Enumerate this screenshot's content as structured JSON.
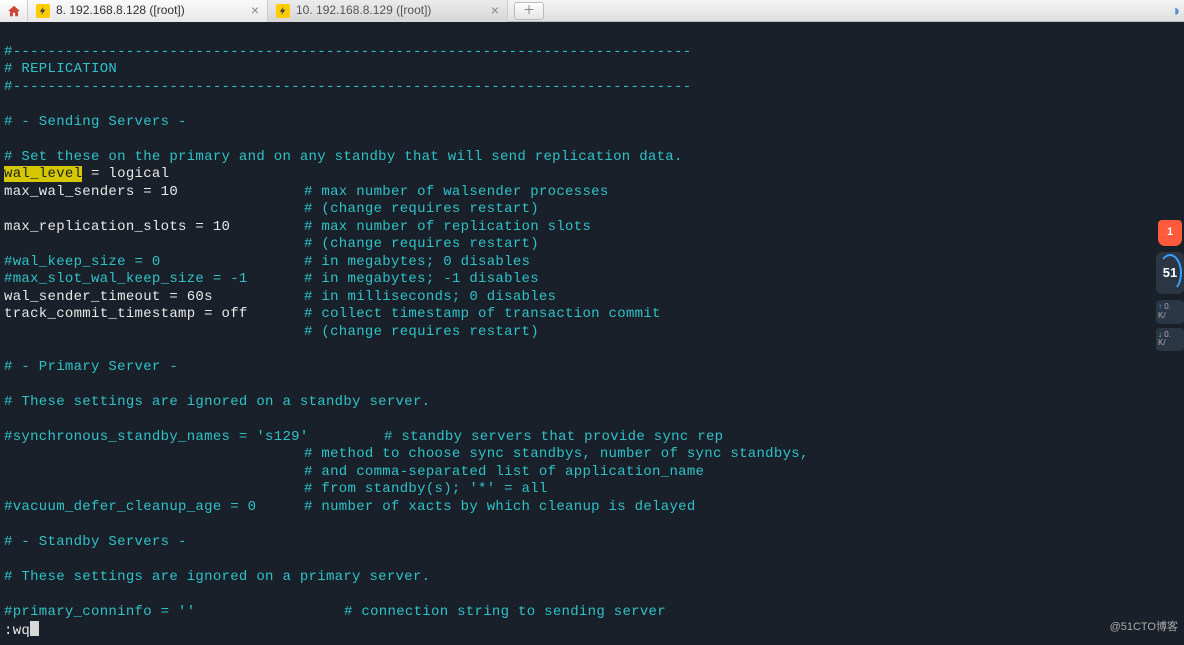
{
  "tabs": [
    {
      "label": "8. 192.168.8.128 ([root])",
      "active": true
    },
    {
      "label": "10. 192.168.8.129 ([root])",
      "active": false
    }
  ],
  "lines": {
    "sep1": "#------------------------------------------------------------------------------",
    "replication": "# REPLICATION",
    "sep2": "#------------------------------------------------------------------------------",
    "blank1": " ",
    "sending": "# - Sending Servers -",
    "blank2": " ",
    "setthese": "# Set these on the primary and on any standby that will send replication data.",
    "wal_level_key": "wal_level",
    "wal_level_rest": " = logical",
    "max_wal_senders": "max_wal_senders = 10",
    "max_wal_senders_c": "# max number of walsender processes",
    "change_restart1": "# (change requires restart)",
    "max_repl_slots": "max_replication_slots = 10",
    "max_repl_slots_c": "# max number of replication slots",
    "change_restart2": "# (change requires restart)",
    "wal_keep_size": "#wal_keep_size = 0",
    "wal_keep_size_c": "# in megabytes; 0 disables",
    "max_slot_wal": "#max_slot_wal_keep_size = -1",
    "max_slot_wal_c": "# in megabytes; -1 disables",
    "wal_sender_timeout": "wal_sender_timeout = 60s",
    "wal_sender_timeout_c": "# in milliseconds; 0 disables",
    "track_commit": "track_commit_timestamp = off",
    "track_commit_c": "# collect timestamp of transaction commit",
    "change_restart3": "# (change requires restart)",
    "blank3": " ",
    "primary": "# - Primary Server -",
    "blank4": " ",
    "ignored_standby": "# These settings are ignored on a standby server.",
    "blank5": " ",
    "sync_standby": "#synchronous_standby_names = 's129'",
    "sync_standby_c": "# standby servers that provide sync rep",
    "method": "# method to choose sync standbys, number of sync standbys,",
    "comma_sep": "# and comma-separated list of application_name",
    "from_standby": "# from standby(s); '*' = all",
    "vacuum_defer": "#vacuum_defer_cleanup_age = 0",
    "vacuum_defer_c": "# number of xacts by which cleanup is delayed",
    "blank6": " ",
    "standby": "# - Standby Servers -",
    "blank7": " ",
    "ignored_primary": "# These settings are ignored on a primary server.",
    "blank8": " ",
    "primary_conninfo": "#primary_conninfo = ''",
    "primary_conninfo_c": "# connection string to sending server",
    "cmdline": ":wq"
  },
  "sidebar": {
    "shield": "1",
    "gauge": "51",
    "up": "0.",
    "up_unit": "K/",
    "down": "0.",
    "down_unit": "K/"
  },
  "watermark": "@51CTO博客"
}
